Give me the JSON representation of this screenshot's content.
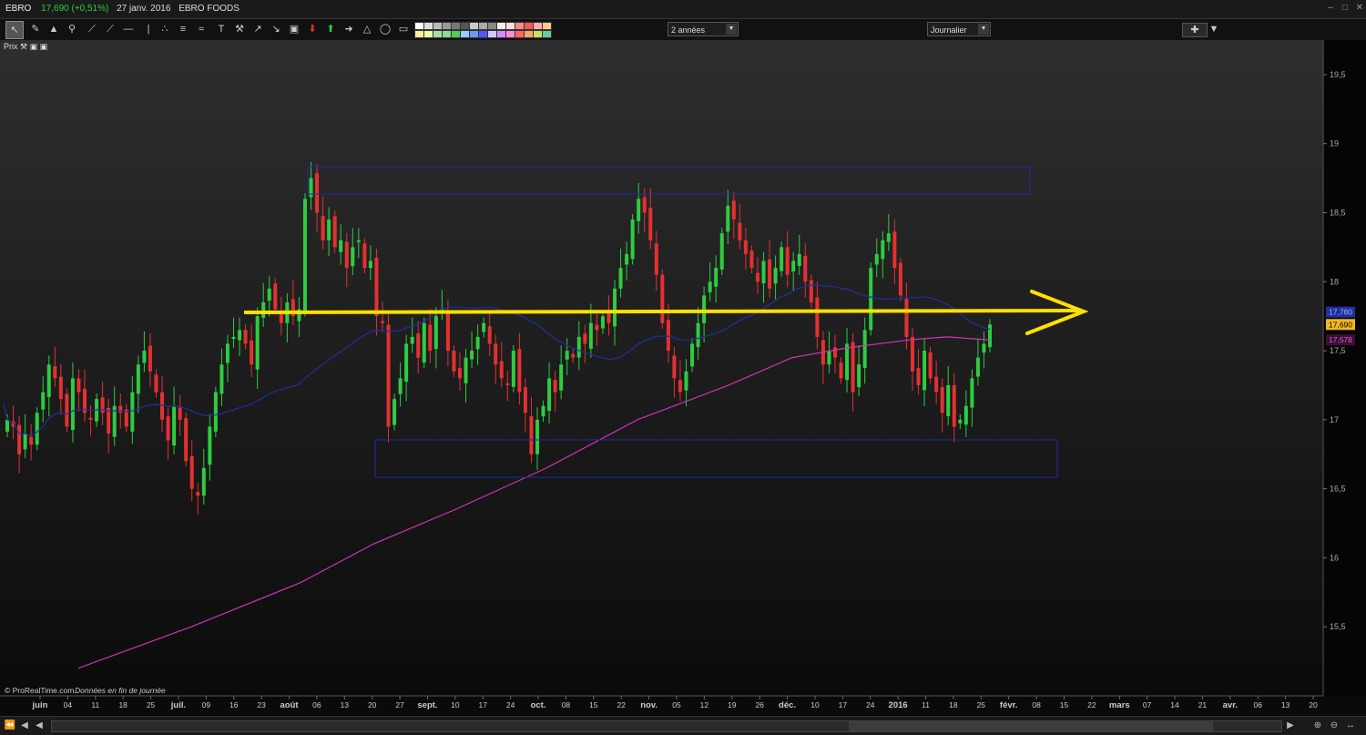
{
  "window": {
    "symbol": "EBRO",
    "price_change": "17,690 (+0,51%)",
    "date": "27 janv. 2016",
    "name": "EBRO FOODS"
  },
  "toolbar": {
    "period_select": "2 années",
    "interval_select": "Journalier",
    "pane_label": "Prix"
  },
  "footer_note": {
    "brand": "© ProRealTime.com",
    "note": "Données en fin de journée"
  },
  "colors": {
    "up": "#2ecc40",
    "down": "#e53030",
    "ma_fast": "#1f2f9c",
    "ma_slow": "#d231b8",
    "trendline": "#ffe000",
    "box": "#1e2aa8",
    "price_tag": "#f2b81a"
  },
  "chart_data": {
    "type": "candlestick",
    "x_labels": [
      "juin",
      "04",
      "11",
      "18",
      "25",
      "juil.",
      "09",
      "16",
      "23",
      "août",
      "06",
      "13",
      "20",
      "27",
      "sept.",
      "10",
      "17",
      "24",
      "oct.",
      "08",
      "15",
      "22",
      "nov.",
      "05",
      "12",
      "19",
      "26",
      "déc.",
      "10",
      "17",
      "24",
      "2016",
      "11",
      "18",
      "25",
      "févr.",
      "08",
      "15",
      "22",
      "mars",
      "07",
      "14",
      "21",
      "avr.",
      "06",
      "13",
      "20"
    ],
    "bold_x_labels": [
      "juin",
      "juil.",
      "août",
      "sept.",
      "oct.",
      "nov.",
      "déc.",
      "2016",
      "févr.",
      "mars",
      "avr."
    ],
    "y_ticks": [
      "19,5",
      "19",
      "18,5",
      "18",
      "17,5",
      "17",
      "16,5",
      "16",
      "15,5"
    ],
    "y_tick_values": [
      19.5,
      19,
      18.5,
      18,
      17.5,
      17,
      16.5,
      16,
      15.5
    ],
    "ylim": [
      15.0,
      19.75
    ],
    "last_close_label": "17,690",
    "ma_slow_label": "17,578",
    "ma_fast_label": "17,780",
    "closes": [
      17.0,
      16.95,
      16.75,
      16.9,
      16.82,
      17.05,
      17.2,
      17.4,
      17.3,
      17.15,
      16.95,
      17.3,
      17.2,
      17.05,
      17.0,
      17.15,
      17.05,
      16.9,
      17.1,
      17.05,
      16.95,
      17.2,
      17.4,
      17.5,
      17.35,
      17.2,
      17.0,
      16.85,
      17.1,
      17.0,
      16.7,
      16.5,
      16.45,
      16.65,
      16.95,
      17.2,
      17.4,
      17.55,
      17.6,
      17.65,
      17.55,
      17.4,
      17.75,
      17.85,
      17.95,
      17.8,
      17.7,
      17.85,
      17.75,
      17.8,
      18.6,
      18.75,
      18.5,
      18.3,
      18.45,
      18.25,
      18.3,
      18.1,
      18.25,
      18.3,
      18.1,
      18.15,
      17.75,
      17.7,
      16.95,
      17.15,
      17.3,
      17.55,
      17.6,
      17.45,
      17.7,
      17.5,
      17.75,
      17.8,
      17.5,
      17.35,
      17.3,
      17.45,
      17.5,
      17.6,
      17.7,
      17.55,
      17.4,
      17.3,
      17.25,
      17.5,
      17.2,
      17.05,
      16.75,
      17.0,
      17.1,
      17.3,
      17.2,
      17.4,
      17.5,
      17.45,
      17.6,
      17.55,
      17.7,
      17.65,
      17.75,
      17.7,
      17.95,
      18.1,
      18.2,
      18.45,
      18.6,
      18.5,
      18.3,
      18.05,
      17.7,
      17.5,
      17.3,
      17.2,
      17.35,
      17.55,
      17.7,
      17.9,
      18.0,
      18.1,
      18.35,
      18.55,
      18.45,
      18.3,
      18.2,
      18.1,
      18.0,
      18.15,
      17.95,
      18.1,
      18.25,
      18.05,
      18.15,
      18.2,
      18.0,
      17.85,
      17.6,
      17.4,
      17.5,
      17.45,
      17.3,
      17.55,
      17.2,
      17.4,
      17.65,
      18.1,
      18.2,
      18.3,
      18.35,
      18.1,
      17.9,
      17.6,
      17.35,
      17.25,
      17.5,
      17.3,
      17.2,
      17.05,
      17.25,
      16.95,
      17.0,
      17.1,
      17.3,
      17.45,
      17.55,
      17.69
    ]
  }
}
